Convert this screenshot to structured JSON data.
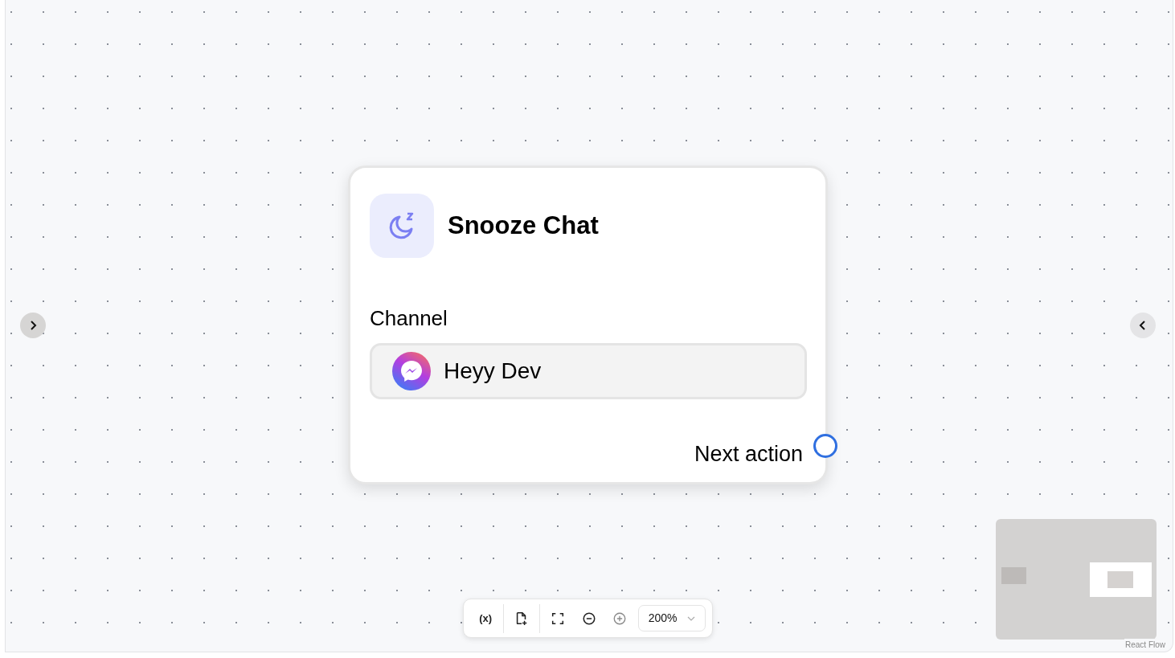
{
  "node": {
    "title": "Snooze Chat",
    "field_label": "Channel",
    "channel": {
      "name": "Heyy Dev"
    },
    "output_label": "Next action"
  },
  "toolbar": {
    "tools": [
      {
        "kind": "variables",
        "text": "(x)",
        "disabled": false
      },
      {
        "kind": "add-file",
        "disabled": false
      },
      {
        "kind": "fit",
        "disabled": false
      },
      {
        "kind": "zoom-out",
        "disabled": false
      },
      {
        "kind": "zoom-in",
        "disabled": true
      }
    ],
    "zoom": "200%"
  },
  "attribution": "React Flow"
}
